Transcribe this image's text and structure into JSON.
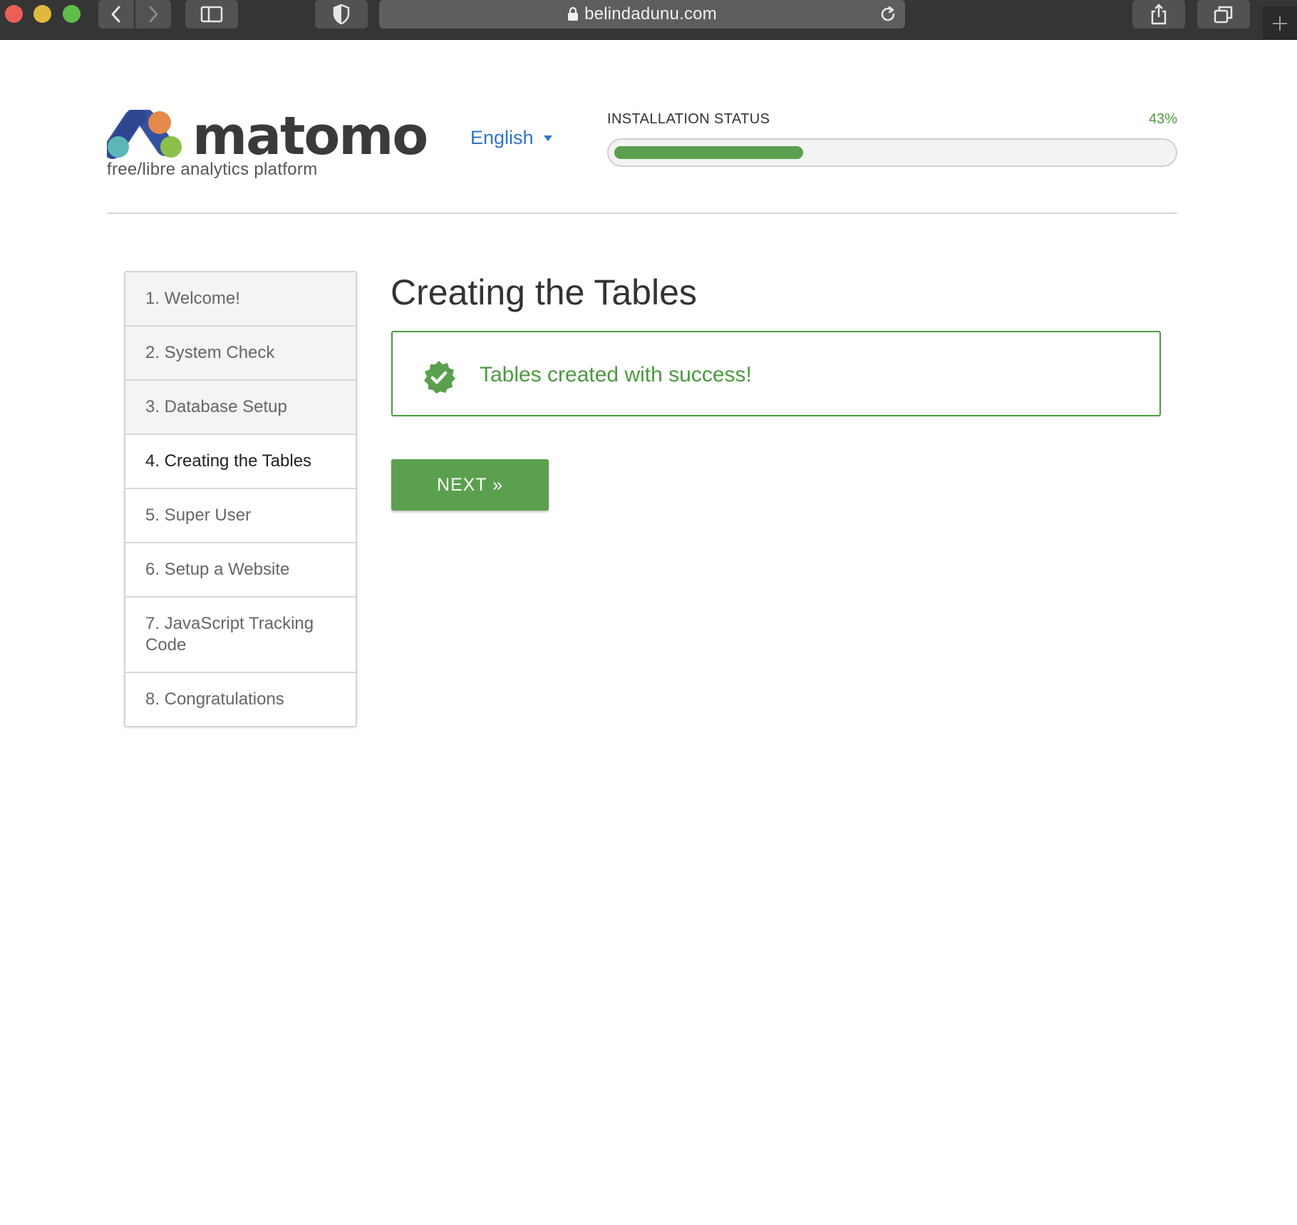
{
  "browser": {
    "url": "belindadunu.com",
    "icons": {
      "back": "chevron-left-icon",
      "forward": "chevron-right-icon",
      "sidebar": "sidebar-icon",
      "privacy": "shield-icon",
      "lock": "lock-icon",
      "reload": "reload-icon",
      "share": "share-icon",
      "tabs": "tabs-overview-icon",
      "new_tab": "plus-icon"
    }
  },
  "header": {
    "logo_text": "matomo",
    "tagline": "free/libre analytics platform",
    "language": "English",
    "status_label": "INSTALLATION STATUS",
    "status_percent_label": "43%",
    "progress_fraction": 0.43
  },
  "steps": [
    {
      "label": "1. Welcome!",
      "state": "done"
    },
    {
      "label": "2. System Check",
      "state": "done"
    },
    {
      "label": "3. Database Setup",
      "state": "done"
    },
    {
      "label": "4. Creating the Tables",
      "state": "current"
    },
    {
      "label": "5. Super User",
      "state": "todo"
    },
    {
      "label": "6. Setup a Website",
      "state": "todo"
    },
    {
      "label": "7. JavaScript Tracking Code",
      "state": "todo"
    },
    {
      "label": "8. Congratulations",
      "state": "todo"
    }
  ],
  "main": {
    "title": "Creating the Tables",
    "success_message": "Tables created with success!",
    "success_icon": "check-badge-icon",
    "next_button": "NEXT »"
  },
  "colors": {
    "accent_green": "#5ba04e",
    "success_green": "#4a9a3d",
    "link_blue": "#3074c4"
  }
}
